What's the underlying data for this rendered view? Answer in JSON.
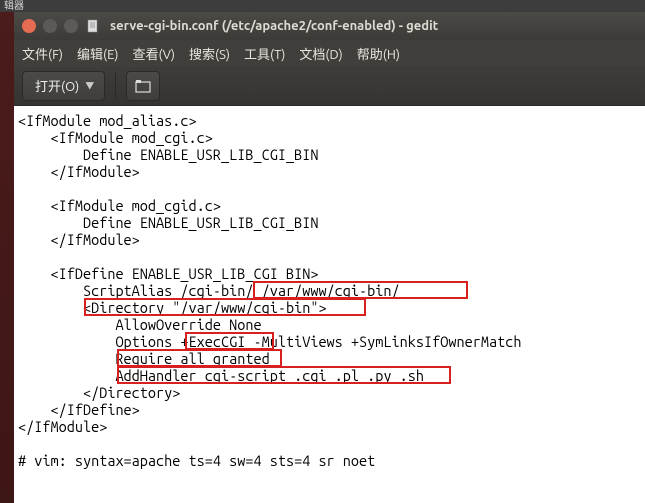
{
  "top_panel_label": "辑器",
  "titlebar": {
    "title": "serve-cgi-bin.conf (/etc/apache2/conf-enabled) - gedit"
  },
  "menu": {
    "file": "文件(F)",
    "edit": "编辑(E)",
    "view": "查看(V)",
    "search": "搜索(S)",
    "tools": "工具(T)",
    "documents": "文档(D)",
    "help": "帮助(H)"
  },
  "toolbar": {
    "open_label": "打开(O)"
  },
  "editor_lines": [
    "<IfModule mod_alias.c>",
    "    <IfModule mod_cgi.c>",
    "        Define ENABLE_USR_LIB_CGI_BIN",
    "    </IfModule>",
    "",
    "    <IfModule mod_cgid.c>",
    "        Define ENABLE_USR_LIB_CGI_BIN",
    "    </IfModule>",
    "",
    "    <IfDefine ENABLE_USR_LIB_CGI_BIN>",
    "        ScriptAlias /cgi-bin/ /var/www/cgi-bin/",
    "        <Directory \"/var/www/cgi-bin\">",
    "            AllowOverride None",
    "            Options +ExecCGI -MultiViews +SymLinksIfOwnerMatch",
    "            Require all granted",
    "            AddHandler cgi-script .cgi .pl .py .sh",
    "        </Directory>",
    "    </IfDefine>",
    "</IfModule>",
    "",
    "# vim: syntax=apache ts=4 sw=4 sts=4 sr noet"
  ]
}
